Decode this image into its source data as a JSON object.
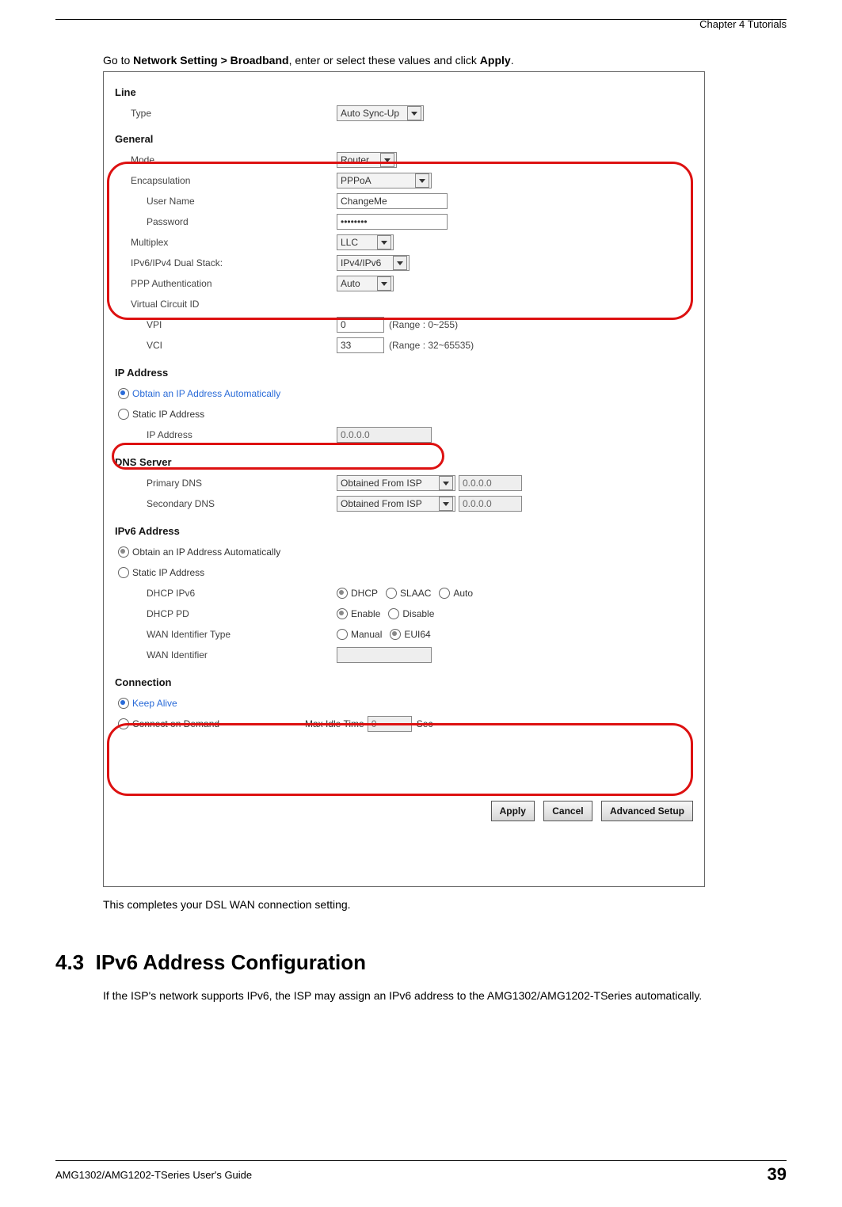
{
  "header": {
    "chapter": "Chapter 4 Tutorials"
  },
  "text": {
    "intro_pre": "Go to ",
    "intro_bold": "Network Setting > Broadband",
    "intro_mid": ", enter or select these values and click ",
    "intro_bold2": "Apply",
    "intro_end": ".",
    "caption": "This completes your DSL WAN connection setting.",
    "section_num": "4.3",
    "section_title": "IPv6 Address Configuration",
    "para": "If the ISP's network supports IPv6, the ISP may assign an IPv6 address to the AMG1302/AMG1202-TSeries automatically."
  },
  "form": {
    "line": {
      "heading": "Line",
      "type_label": "Type",
      "type_value": "Auto Sync-Up"
    },
    "general": {
      "heading": "General",
      "mode_label": "Mode",
      "mode_value": "Router",
      "encap_label": "Encapsulation",
      "encap_value": "PPPoA",
      "user_label": "User Name",
      "user_value": "ChangeMe",
      "pass_label": "Password",
      "pass_value": "••••••••",
      "mux_label": "Multiplex",
      "mux_value": "LLC",
      "dual_label": "IPv6/IPv4 Dual Stack:",
      "dual_value": "IPv4/IPv6",
      "pppauth_label": "PPP Authentication",
      "pppauth_value": "Auto",
      "vcid_label": "Virtual Circuit ID",
      "vpi_label": "VPI",
      "vpi_value": "0",
      "vpi_range": "(Range : 0~255)",
      "vci_label": "VCI",
      "vci_value": "33",
      "vci_range": "(Range : 32~65535)"
    },
    "ip": {
      "heading": "IP Address",
      "auto": "Obtain an IP Address Automatically",
      "static": "Static IP Address",
      "ipaddr_label": "IP Address",
      "ipaddr_value": "0.0.0.0"
    },
    "dns": {
      "heading": "DNS Server",
      "primary_label": "Primary DNS",
      "primary_value": "Obtained From ISP",
      "primary_ip": "0.0.0.0",
      "secondary_label": "Secondary DNS",
      "secondary_value": "Obtained From ISP",
      "secondary_ip": "0.0.0.0"
    },
    "ipv6": {
      "heading": "IPv6 Address",
      "auto": "Obtain an IP Address Automatically",
      "static": "Static IP Address",
      "dhcpipv6_label": "DHCP IPv6",
      "dhcp": "DHCP",
      "slaac": "SLAAC",
      "autoopt": "Auto",
      "dhcppd_label": "DHCP PD",
      "enable": "Enable",
      "disable": "Disable",
      "wanid_label": "WAN Identifier Type",
      "manual": "Manual",
      "eui64": "EUI64",
      "wanident_label": "WAN Identifier"
    },
    "conn": {
      "heading": "Connection",
      "keepalive": "Keep Alive",
      "ondemand": "Connect on Demand",
      "maxidle_label": "Max Idle Time",
      "maxidle_value": "0",
      "sec": "Sec"
    },
    "buttons": {
      "apply": "Apply",
      "cancel": "Cancel",
      "advanced": "Advanced Setup"
    }
  },
  "footer": {
    "guide": "AMG1302/AMG1202-TSeries User's Guide",
    "page": "39"
  }
}
